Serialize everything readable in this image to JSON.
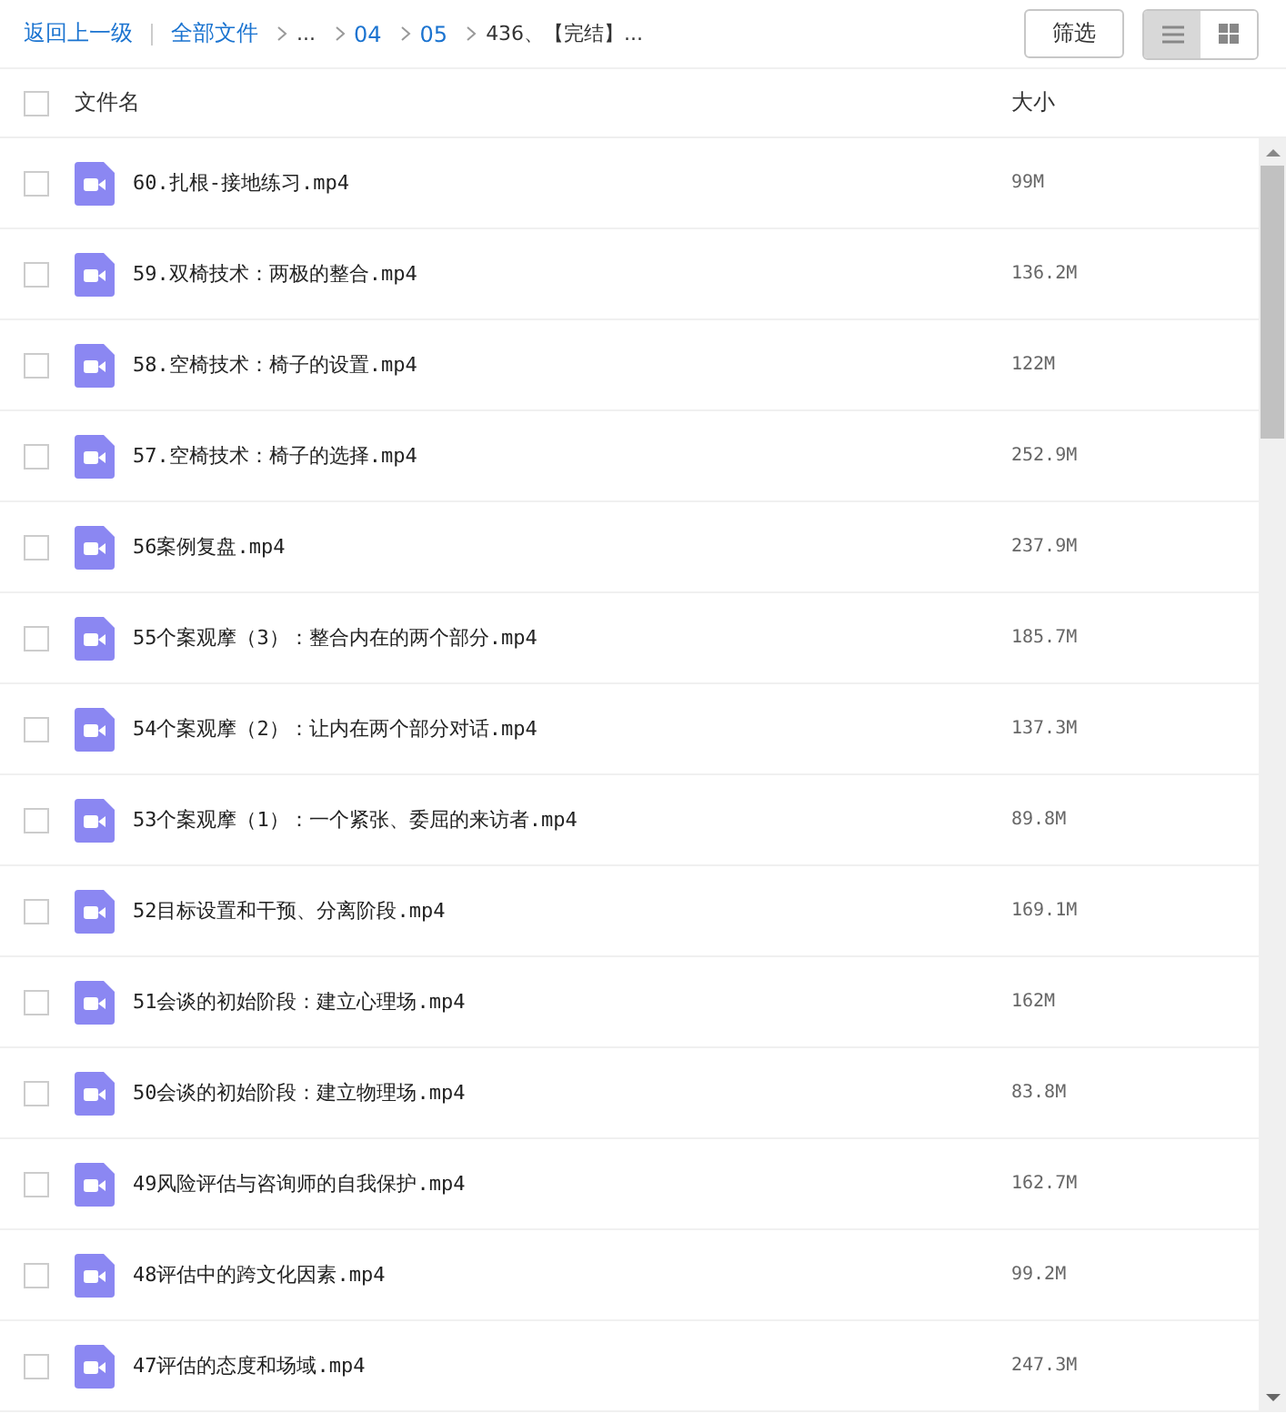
{
  "toolbar": {
    "back_link": "返回上一级",
    "all_files_link": "全部文件",
    "breadcrumbs": [
      {
        "label": "...",
        "link": false
      },
      {
        "label": "04",
        "link": true
      },
      {
        "label": "05",
        "link": true
      },
      {
        "label": "436、【完结】...",
        "link": false
      }
    ],
    "filter_button": "筛选",
    "view_toggles": [
      {
        "kind": "list",
        "selected": true
      },
      {
        "kind": "grid",
        "selected": false
      }
    ]
  },
  "table": {
    "select_all_checked": false,
    "columns": [
      "文件名",
      "大小"
    ],
    "rows": [
      {
        "name": "60.扎根-接地练习.mp4",
        "size": "99M",
        "checked": false
      },
      {
        "name": "59.双椅技术：两极的整合.mp4",
        "size": "136.2M",
        "checked": false
      },
      {
        "name": "58.空椅技术：椅子的设置.mp4",
        "size": "122M",
        "checked": false
      },
      {
        "name": "57.空椅技术：椅子的选择.mp4",
        "size": "252.9M",
        "checked": false
      },
      {
        "name": "56案例复盘.mp4",
        "size": "237.9M",
        "checked": false
      },
      {
        "name": "55个案观摩（3）：整合内在的两个部分.mp4",
        "size": "185.7M",
        "checked": false
      },
      {
        "name": "54个案观摩（2）：让内在两个部分对话.mp4",
        "size": "137.3M",
        "checked": false
      },
      {
        "name": "53个案观摩（1）：一个紧张、委屈的来访者.mp4",
        "size": "89.8M",
        "checked": false
      },
      {
        "name": "52目标设置和干预、分离阶段.mp4",
        "size": "169.1M",
        "checked": false
      },
      {
        "name": "51会谈的初始阶段：建立心理场.mp4",
        "size": "162M",
        "checked": false
      },
      {
        "name": "50会谈的初始阶段：建立物理场.mp4",
        "size": "83.8M",
        "checked": false
      },
      {
        "name": "49风险评估与咨询师的自我保护.mp4",
        "size": "162.7M",
        "checked": false
      },
      {
        "name": "48评估中的跨文化因素.mp4",
        "size": "99.2M",
        "checked": false
      },
      {
        "name": "47评估的态度和场域.mp4",
        "size": "247.3M",
        "checked": false
      }
    ]
  }
}
